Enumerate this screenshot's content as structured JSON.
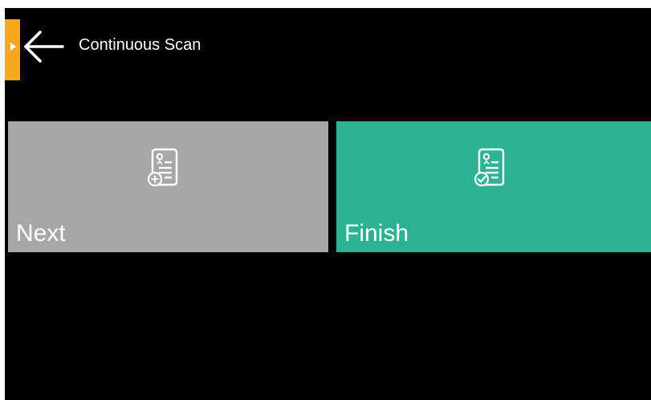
{
  "header": {
    "title": "Continuous Scan",
    "back_icon": "arrow-left-icon",
    "side_tab_icon": "play-triangle-icon"
  },
  "tiles": [
    {
      "label": "Next",
      "icon": "document-add-icon",
      "color": "#a8a7a8"
    },
    {
      "label": "Finish",
      "icon": "document-check-icon",
      "color": "#2bb394"
    }
  ],
  "colors": {
    "background": "#000000",
    "accent": "#f7a81b",
    "text": "#ffffff"
  }
}
